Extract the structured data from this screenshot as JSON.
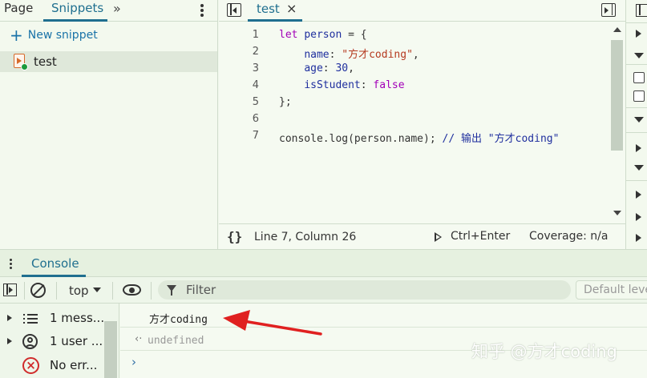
{
  "sources": {
    "tabs": [
      "Page",
      "Snippets"
    ],
    "more_label": "»",
    "new_snippet_label": "New snippet",
    "snippets": [
      {
        "name": "test"
      }
    ]
  },
  "editor": {
    "file_tab": "test",
    "close_label": "×",
    "code": [
      {
        "n": "1",
        "tokens": [
          [
            "kw",
            "let"
          ],
          [
            "plain",
            " "
          ],
          [
            "id",
            "person"
          ],
          [
            "plain",
            " = {"
          ]
        ]
      },
      {
        "n": "2",
        "tokens": [
          [
            "plain",
            "    "
          ],
          [
            "prop",
            "name"
          ],
          [
            "plain",
            ": "
          ],
          [
            "str",
            "\"方才coding\""
          ],
          [
            "plain",
            ","
          ]
        ]
      },
      {
        "n": "3",
        "tokens": [
          [
            "plain",
            "    "
          ],
          [
            "prop",
            "age"
          ],
          [
            "plain",
            ": "
          ],
          [
            "num",
            "30"
          ],
          [
            "plain",
            ","
          ]
        ]
      },
      {
        "n": "4",
        "tokens": [
          [
            "plain",
            "    "
          ],
          [
            "prop",
            "isStudent"
          ],
          [
            "plain",
            ": "
          ],
          [
            "kw",
            "false"
          ]
        ]
      },
      {
        "n": "5",
        "tokens": [
          [
            "plain",
            "};"
          ]
        ]
      },
      {
        "n": "6",
        "tokens": []
      },
      {
        "n": "7",
        "tokens": [
          [
            "plain",
            "console.log(person.name); "
          ],
          [
            "cmt",
            "// 输出 \"方才coding\""
          ]
        ]
      }
    ],
    "status": {
      "braces": "{}",
      "position": "Line 7, Column 26",
      "run_label": "Ctrl+Enter",
      "coverage": "Coverage: n/a"
    }
  },
  "drawer": {
    "tab": "Console"
  },
  "toolbar": {
    "context": "top",
    "filter_placeholder": "Filter",
    "levels": "Default levels"
  },
  "console_sidebar": [
    {
      "icon": "list-icon",
      "label": "1 mess..."
    },
    {
      "icon": "user-icon",
      "label": "1 user ..."
    },
    {
      "icon": "error-icon",
      "label": "No err..."
    }
  ],
  "console_output": {
    "log": "方才coding",
    "result": "undefined",
    "prompt": "›"
  },
  "annotation": {
    "color": "#e02020"
  },
  "watermark": "知乎 @方才coding"
}
